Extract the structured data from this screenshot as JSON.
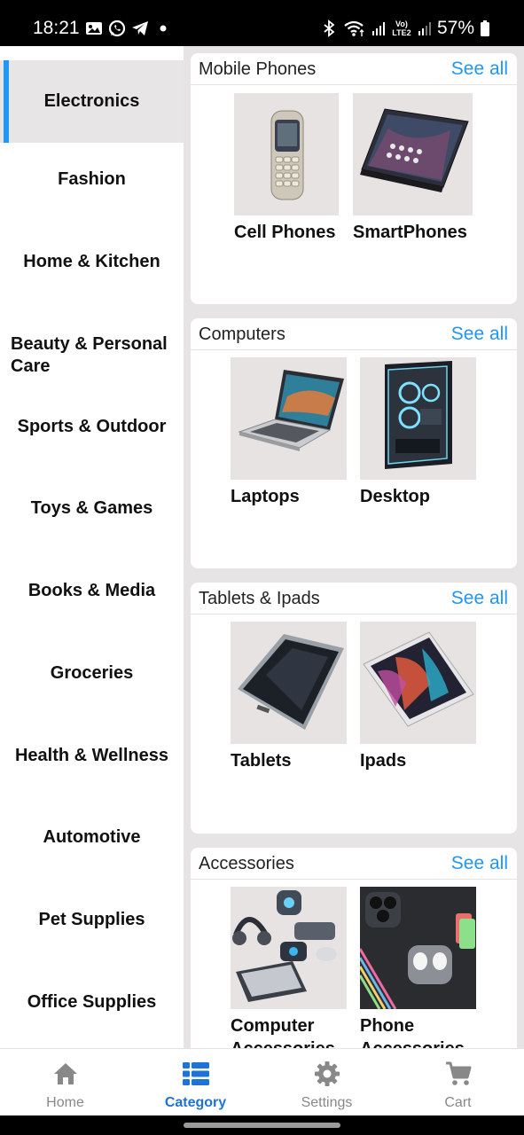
{
  "status_bar": {
    "time": "18:21",
    "left_icons": [
      "gallery-icon",
      "whatsapp-icon",
      "telegram-icon",
      "dot-icon"
    ],
    "right_icons": [
      "bluetooth-icon",
      "wifi-icon",
      "signal-icon",
      "volte-icon",
      "signal-icon"
    ],
    "network_label": "Vo) LTE2",
    "battery": "57%"
  },
  "sidebar": {
    "items": [
      {
        "label": "Electronics",
        "active": true
      },
      {
        "label": "Fashion"
      },
      {
        "label": "Home & Kitchen"
      },
      {
        "label": "Beauty & Personal Care"
      },
      {
        "label": "Sports & Outdoor"
      },
      {
        "label": "Toys & Games"
      },
      {
        "label": "Books & Media"
      },
      {
        "label": "Groceries"
      },
      {
        "label": "Health & Wellness"
      },
      {
        "label": "Automotive"
      },
      {
        "label": "Pet Supplies"
      },
      {
        "label": "Office Supplies"
      }
    ]
  },
  "sections": [
    {
      "title": "Mobile Phones",
      "see_all": "See all",
      "products": [
        {
          "name": "Cell Phones"
        },
        {
          "name": "SmartPhones"
        }
      ]
    },
    {
      "title": "Computers",
      "see_all": "See all",
      "products": [
        {
          "name": "Laptops"
        },
        {
          "name": "Desktop"
        }
      ]
    },
    {
      "title": "Tablets & Ipads",
      "see_all": "See all",
      "products": [
        {
          "name": "Tablets"
        },
        {
          "name": "Ipads"
        }
      ]
    },
    {
      "title": "Accessories",
      "see_all": "See all",
      "products": [
        {
          "name": "Computer Accessories"
        },
        {
          "name": "Phone Accessories"
        }
      ]
    }
  ],
  "bottom_nav": {
    "items": [
      {
        "label": "Home",
        "icon": "home-icon"
      },
      {
        "label": "Category",
        "icon": "list-icon",
        "active": true
      },
      {
        "label": "Settings",
        "icon": "gear-icon"
      },
      {
        "label": "Cart",
        "icon": "cart-icon"
      }
    ]
  },
  "colors": {
    "accent": "#2196f3",
    "active_nav": "#1e73d8",
    "content_bg": "#e6e4e4",
    "sidebar_active_bg": "#e7e5e5"
  }
}
